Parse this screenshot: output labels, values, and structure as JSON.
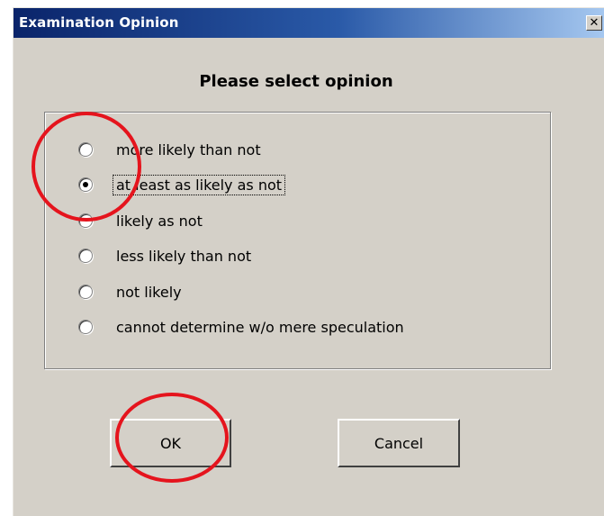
{
  "window": {
    "title": "Examination Opinion",
    "close_label": "✕",
    "prompt": "Please select opinion"
  },
  "options": [
    {
      "label": "more likely than not",
      "checked": false
    },
    {
      "label": "at least as likely as not",
      "checked": true,
      "focused": true
    },
    {
      "label": "likely as not",
      "checked": false
    },
    {
      "label": "less likely than not",
      "checked": false
    },
    {
      "label": "not likely",
      "checked": false
    },
    {
      "label": "cannot determine w/o mere speculation",
      "checked": false
    }
  ],
  "buttons": {
    "ok_label": "OK",
    "cancel_label": "Cancel"
  },
  "annotations": {
    "circle_color": "#e5141d"
  },
  "colors": {
    "dialog_bg": "#d4d0c8",
    "titlebar_start": "#0a246a",
    "titlebar_end": "#a6c8f0"
  }
}
